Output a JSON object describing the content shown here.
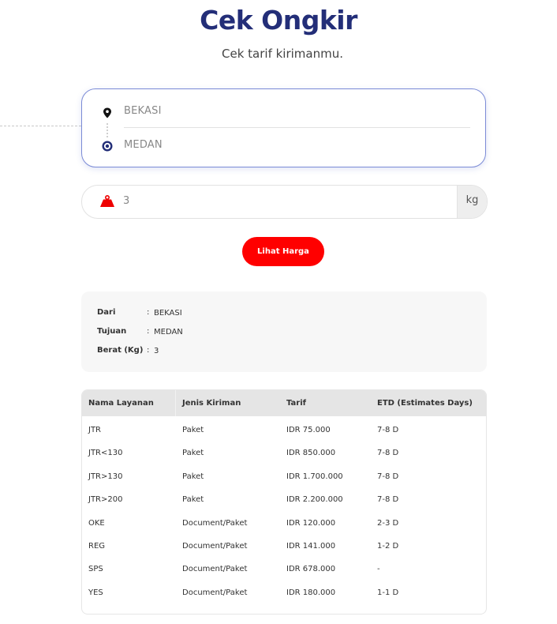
{
  "header": {
    "title": "Cek Ongkir",
    "subtitle": "Cek tarif kirimanmu."
  },
  "route": {
    "origin_value": "BEKASI",
    "destination_value": "MEDAN",
    "origin_icon": "location-pin-icon",
    "destination_icon": "destination-circle-icon"
  },
  "weight": {
    "value": "3",
    "unit": "kg",
    "icon": "weight-icon"
  },
  "cta": {
    "label": "Lihat Harga"
  },
  "summary": {
    "rows": [
      {
        "label": "Dari",
        "colon": ":",
        "value": "BEKASI"
      },
      {
        "label": "Tujuan",
        "colon": ":",
        "value": "MEDAN"
      },
      {
        "label": "Berat (Kg)",
        "colon": ":",
        "value": "3"
      }
    ]
  },
  "table": {
    "headers": [
      "Nama Layanan",
      "Jenis Kiriman",
      "Tarif",
      "ETD (Estimates Days)"
    ],
    "rows": [
      [
        "JTR",
        "Paket",
        "IDR 75.000",
        "7-8 D"
      ],
      [
        "JTR<130",
        "Paket",
        "IDR 850.000",
        "7-8 D"
      ],
      [
        "JTR>130",
        "Paket",
        "IDR 1.700.000",
        "7-8 D"
      ],
      [
        "JTR>200",
        "Paket",
        "IDR 2.200.000",
        "7-8 D"
      ],
      [
        "OKE",
        "Document/Paket",
        "IDR 120.000",
        "2-3 D"
      ],
      [
        "REG",
        "Document/Paket",
        "IDR 141.000",
        "1-2 D"
      ],
      [
        "SPS",
        "Document/Paket",
        "IDR 678.000",
        "-"
      ],
      [
        "YES",
        "Document/Paket",
        "IDR 180.000",
        "1-1 D"
      ]
    ]
  },
  "colors": {
    "title": "#232e78",
    "accent_red": "#ff0000",
    "route_border": "#7b8bd6",
    "table_header_bg": "#e5e5e5"
  }
}
